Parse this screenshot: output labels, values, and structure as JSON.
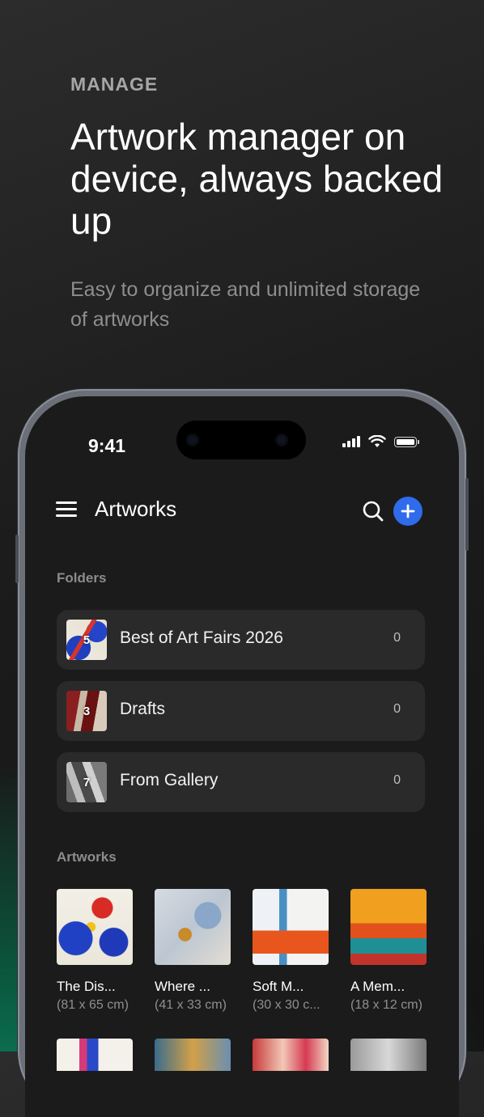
{
  "promo": {
    "kicker": "MANAGE",
    "headline": "Artwork manager on device, always backed up",
    "subtitle": "Easy to organize and unlimited storage of artworks"
  },
  "status": {
    "time": "9:41"
  },
  "header": {
    "title": "Artworks"
  },
  "folders": {
    "label": "Folders",
    "items": [
      {
        "name": "Best of Art Fairs 2026",
        "thumb_count": "5",
        "count": "0"
      },
      {
        "name": "Drafts",
        "thumb_count": "3",
        "count": "0"
      },
      {
        "name": "From Gallery",
        "thumb_count": "7",
        "count": "0"
      }
    ]
  },
  "artworks": {
    "label": "Artworks",
    "items": [
      {
        "title": "The Dis...",
        "dims": "(81 x 65 cm)"
      },
      {
        "title": "Where ...",
        "dims": "(41 x 33 cm)"
      },
      {
        "title": "Soft M...",
        "dims": "(30 x 30 c..."
      },
      {
        "title": "A Mem...",
        "dims": "(18 x 12 cm)"
      }
    ]
  },
  "colors": {
    "accent": "#2f6bea",
    "background": "#1b1b1b",
    "card": "#2a2a2a"
  }
}
